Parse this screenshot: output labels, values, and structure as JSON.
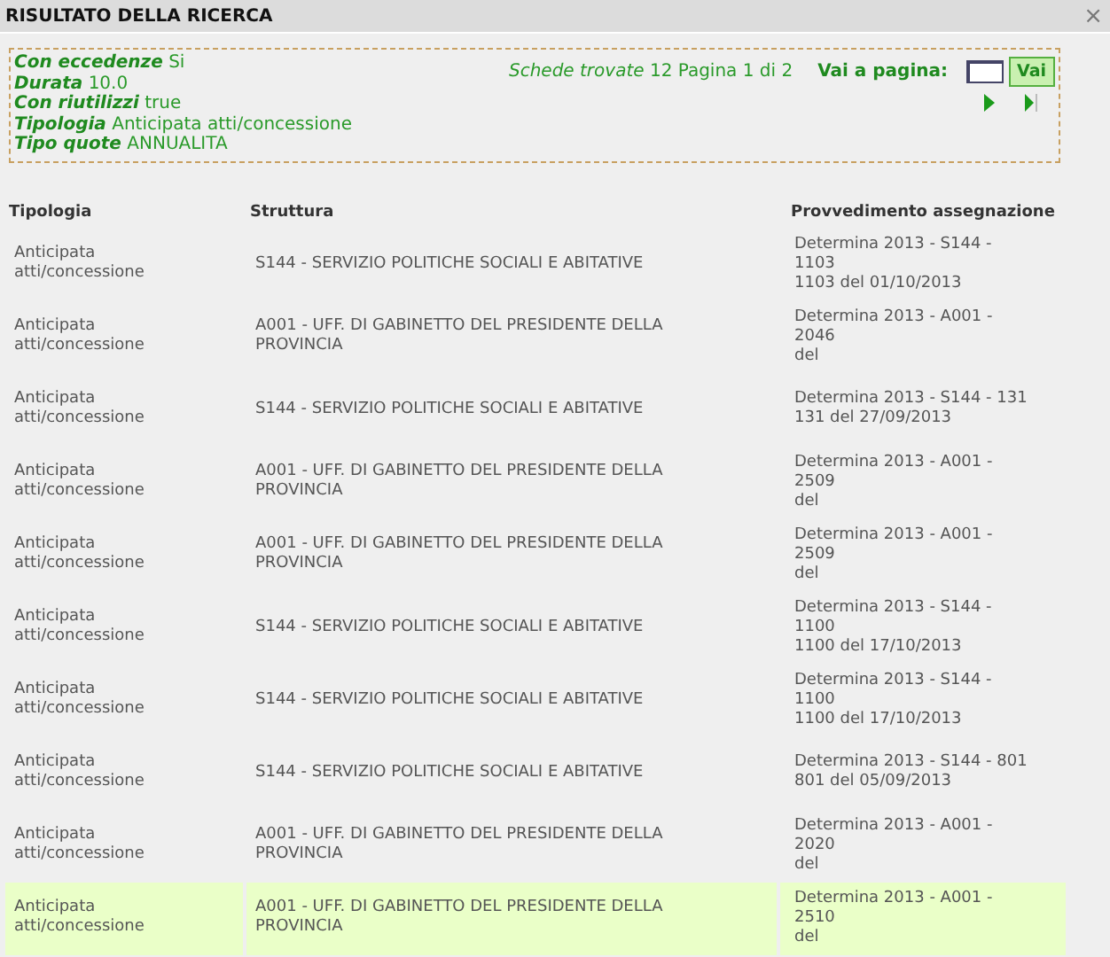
{
  "window": {
    "title": "RISULTATO DELLA RICERCA",
    "close": "×"
  },
  "filters": [
    {
      "label": "Con eccedenze",
      "value": "Si"
    },
    {
      "label": "Durata",
      "value": "10.0"
    },
    {
      "label": "Con riutilizzi",
      "value": "true"
    },
    {
      "label": "Tipologia",
      "value": "Anticipata atti/concessione"
    },
    {
      "label": "Tipo quote",
      "value": "ANNUALITA"
    }
  ],
  "results": {
    "label": "Schede trovate",
    "count": "12",
    "page_text": "Pagina 1 di 2"
  },
  "goto": {
    "label": "Vai a pagina:",
    "button": "Vai"
  },
  "table": {
    "columns": [
      "Tipologia",
      "Struttura",
      "Provvedimento assegnazione"
    ],
    "rows": [
      {
        "selected": false,
        "tipologia": "Anticipata atti/concessione",
        "struttura": "S144 - SERVIZIO POLITICHE SOCIALI E ABITATIVE",
        "provvedimento": [
          "Determina 2013 - S144 -",
          "1103",
          "1103 del 01/10/2013"
        ]
      },
      {
        "selected": false,
        "tipologia": "Anticipata atti/concessione",
        "struttura": "A001 - UFF. DI GABINETTO DEL PRESIDENTE DELLA PROVINCIA",
        "provvedimento": [
          "Determina 2013 - A001 -",
          "2046",
          "del"
        ]
      },
      {
        "selected": false,
        "tipologia": "Anticipata atti/concessione",
        "struttura": "S144 - SERVIZIO POLITICHE SOCIALI E ABITATIVE",
        "provvedimento": [
          "Determina 2013 - S144 - 131",
          "131 del 27/09/2013"
        ]
      },
      {
        "selected": false,
        "tipologia": "Anticipata atti/concessione",
        "struttura": "A001 - UFF. DI GABINETTO DEL PRESIDENTE DELLA PROVINCIA",
        "provvedimento": [
          "Determina 2013 - A001 -",
          "2509",
          "del"
        ]
      },
      {
        "selected": false,
        "tipologia": "Anticipata atti/concessione",
        "struttura": "A001 - UFF. DI GABINETTO DEL PRESIDENTE DELLA PROVINCIA",
        "provvedimento": [
          "Determina 2013 - A001 -",
          "2509",
          "del"
        ]
      },
      {
        "selected": false,
        "tipologia": "Anticipata atti/concessione",
        "struttura": "S144 - SERVIZIO POLITICHE SOCIALI E ABITATIVE",
        "provvedimento": [
          "Determina 2013 - S144 -",
          "1100",
          "1100 del 17/10/2013"
        ]
      },
      {
        "selected": false,
        "tipologia": "Anticipata atti/concessione",
        "struttura": "S144 - SERVIZIO POLITICHE SOCIALI E ABITATIVE",
        "provvedimento": [
          "Determina 2013 - S144 -",
          "1100",
          "1100 del 17/10/2013"
        ]
      },
      {
        "selected": false,
        "tipologia": "Anticipata atti/concessione",
        "struttura": "S144 - SERVIZIO POLITICHE SOCIALI E ABITATIVE",
        "provvedimento": [
          "Determina 2013 - S144 - 801",
          "801 del 05/09/2013"
        ]
      },
      {
        "selected": false,
        "tipologia": "Anticipata atti/concessione",
        "struttura": "A001 - UFF. DI GABINETTO DEL PRESIDENTE DELLA PROVINCIA",
        "provvedimento": [
          "Determina 2013 - A001 -",
          "2020",
          "del"
        ]
      },
      {
        "selected": true,
        "tipologia": "Anticipata atti/concessione",
        "struttura": "A001 - UFF. DI GABINETTO DEL PRESIDENTE DELLA PROVINCIA",
        "provvedimento": [
          "Determina 2013 - A001 -",
          "2510",
          "del"
        ]
      }
    ]
  }
}
